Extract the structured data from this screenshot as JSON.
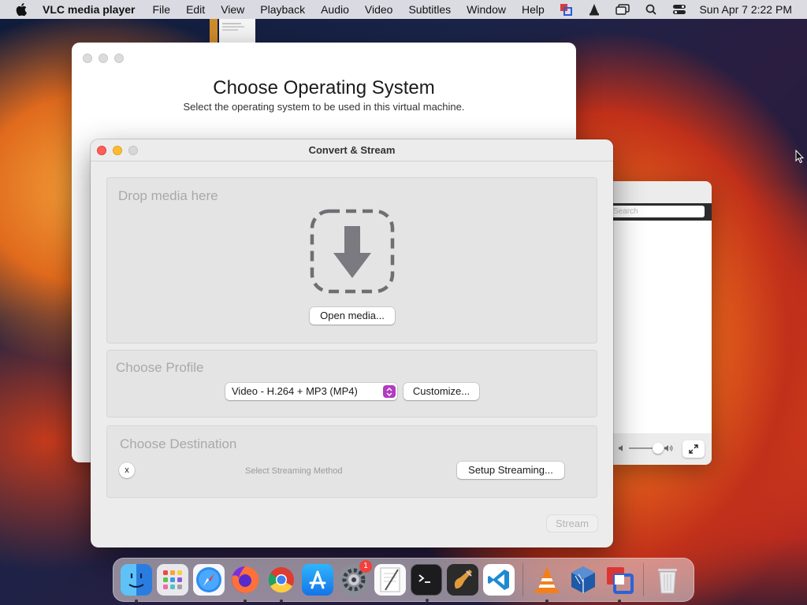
{
  "menubar": {
    "app_name": "VLC media player",
    "items": [
      "File",
      "Edit",
      "View",
      "Playback",
      "Audio",
      "Video",
      "Subtitles",
      "Window",
      "Help"
    ],
    "datetime": "Sun Apr 7  2:22 PM",
    "status_icons": [
      "parallels-icon",
      "vlc-cone-icon",
      "screen-mirroring-icon",
      "search-icon",
      "control-center-icon"
    ]
  },
  "bg_window": {
    "title": "Choose Operating System",
    "subtitle": "Select the operating system to be used in this virtual machine."
  },
  "vlc_playlist": {
    "search_placeholder": "Search"
  },
  "dialog": {
    "title": "Convert & Stream",
    "drop": {
      "heading": "Drop media here",
      "open_button": "Open media..."
    },
    "profile": {
      "heading": "Choose Profile",
      "selected": "Video - H.264 + MP3 (MP4)",
      "customize_button": "Customize..."
    },
    "destination": {
      "heading": "Choose Destination",
      "clear_button": "x",
      "method_text": "Select Streaming Method",
      "setup_button": "Setup Streaming..."
    },
    "stream_button": "Stream"
  },
  "dock": {
    "apps": [
      {
        "name": "Finder",
        "icon": "finder-icon",
        "running": true
      },
      {
        "name": "Launchpad",
        "icon": "launchpad-icon",
        "running": false
      },
      {
        "name": "Safari",
        "icon": "safari-icon",
        "running": false
      },
      {
        "name": "Firefox",
        "icon": "firefox-icon",
        "running": true
      },
      {
        "name": "Chrome",
        "icon": "chrome-icon",
        "running": true
      },
      {
        "name": "App Store",
        "icon": "app-store-icon",
        "running": false
      },
      {
        "name": "System Preferences",
        "icon": "system-preferences-icon",
        "running": false,
        "badge": "1"
      },
      {
        "name": "TextEdit",
        "icon": "textedit-icon",
        "running": false
      },
      {
        "name": "Terminal",
        "icon": "terminal-icon",
        "running": true
      },
      {
        "name": "Instruments",
        "icon": "instruments-icon",
        "running": false
      },
      {
        "name": "VS Code",
        "icon": "vscode-icon",
        "running": false
      },
      {
        "name": "VLC",
        "icon": "vlc-icon",
        "running": true
      },
      {
        "name": "VirtualBox",
        "icon": "virtualbox-icon",
        "running": false
      },
      {
        "name": "Parallels",
        "icon": "parallels-icon",
        "running": true
      },
      {
        "name": "Trash",
        "icon": "trash-icon",
        "running": false
      }
    ]
  }
}
